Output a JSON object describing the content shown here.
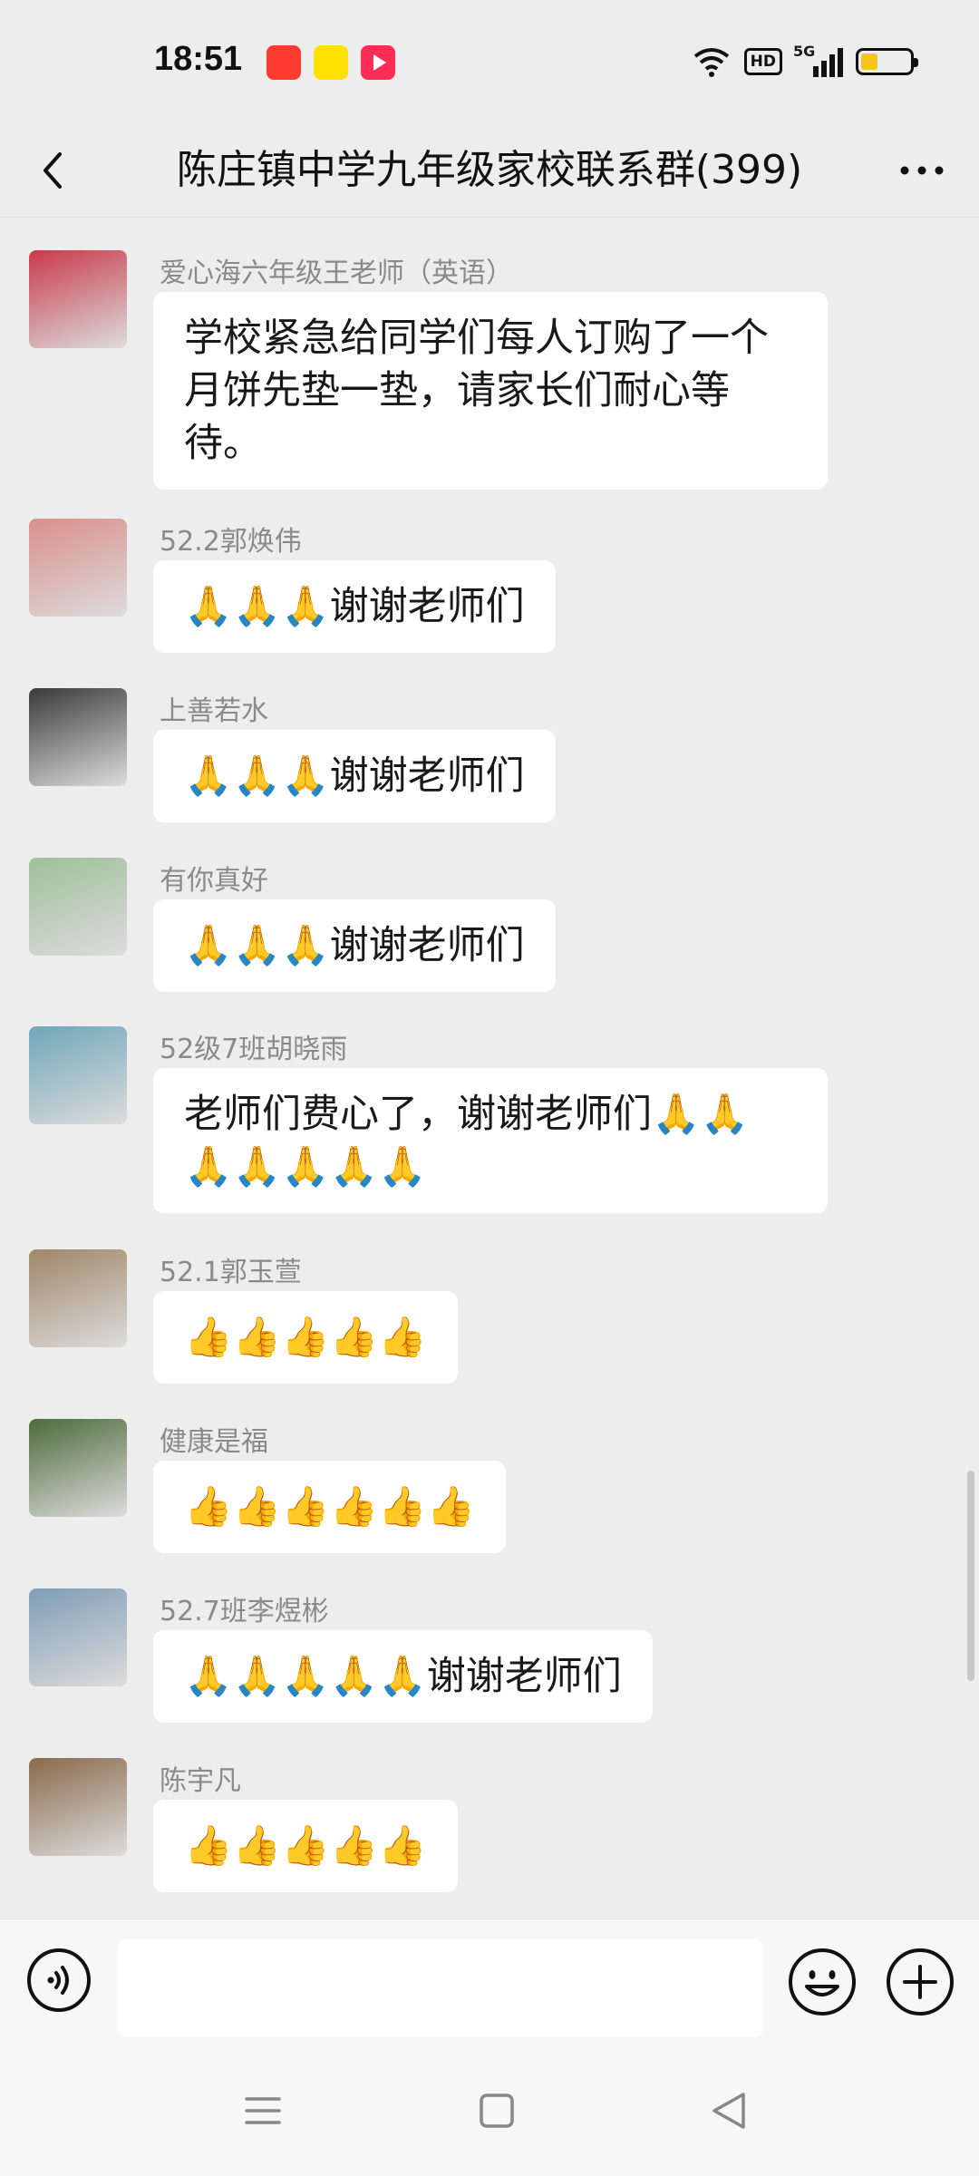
{
  "status_bar": {
    "time": "18:51",
    "app_icons": [
      "du-app-icon",
      "yy-app-icon",
      "video-app-icon"
    ],
    "hd_label": "HD",
    "network_label": "5G",
    "battery_level": 0.35
  },
  "header": {
    "title": "陈庄镇中学九年级家校联系群(399)",
    "back_icon": "chevron-left-icon",
    "more_icon": "more-dots-icon"
  },
  "messages": [
    {
      "sender": "爱心海六年级王老师（英语）",
      "text": "学校紧急给同学们每人订购了一个月饼先垫一垫，请家长们耐心等待。",
      "avatar_color": "#c93a4a"
    },
    {
      "sender": "52.2郭焕伟",
      "text": "🙏🙏🙏谢谢老师们",
      "avatar_color": "#d98f8a"
    },
    {
      "sender": "上善若水",
      "text": "🙏🙏🙏谢谢老师们",
      "avatar_color": "#3a3a3a"
    },
    {
      "sender": "有你真好",
      "text": "🙏🙏🙏谢谢老师们",
      "avatar_color": "#9fbf9a"
    },
    {
      "sender": "52级7班胡晓雨",
      "text": "老师们费心了，谢谢老师们🙏🙏🙏🙏🙏🙏🙏",
      "avatar_color": "#6fa7b8"
    },
    {
      "sender": "52.1郭玉萱",
      "text": "👍👍👍👍👍",
      "avatar_color": "#a08668"
    },
    {
      "sender": "健康是福",
      "text": "👍👍👍👍👍👍",
      "avatar_color": "#4d6b3a"
    },
    {
      "sender": "52.7班李煜彬",
      "text": "🙏🙏🙏🙏🙏谢谢老师们",
      "avatar_color": "#7f9db5"
    },
    {
      "sender": "陈宇凡",
      "text": "👍👍👍👍👍",
      "avatar_color": "#8a6a4a"
    }
  ],
  "input_bar": {
    "text_value": "",
    "voice_icon": "voice-icon",
    "emoji_icon": "emoji-icon",
    "plus_icon": "plus-icon"
  },
  "nav_bar": {
    "icons": [
      "menu-icon",
      "home-icon",
      "back-triangle-icon"
    ]
  }
}
